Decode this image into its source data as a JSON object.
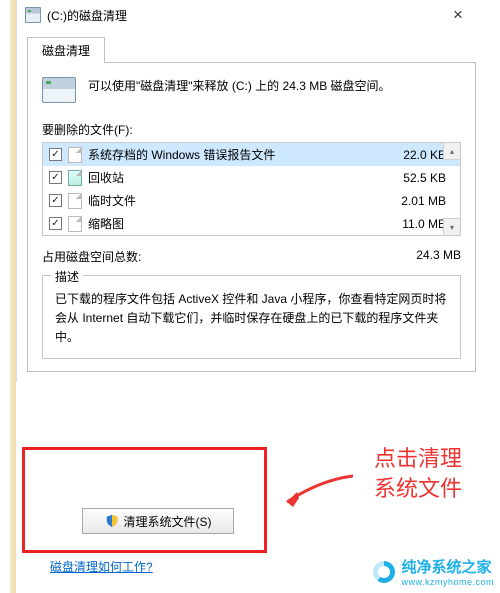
{
  "title": "(C:)的磁盘清理",
  "tab_label": "磁盘清理",
  "summary": "可以使用\"磁盘清理\"来释放  (C:) 上的 24.3 MB 磁盘空间。",
  "files_label": "要删除的文件(F):",
  "files": [
    {
      "name": "系统存档的 Windows 错误报告文件",
      "size": "22.0 KB",
      "checked": true,
      "iconType": "file",
      "selected": true
    },
    {
      "name": "回收站",
      "size": "52.5 KB",
      "checked": true,
      "iconType": "recycle",
      "selected": false
    },
    {
      "name": "临时文件",
      "size": "2.01 MB",
      "checked": true,
      "iconType": "file",
      "selected": false
    },
    {
      "name": "缩略图",
      "size": "11.0 MB",
      "checked": true,
      "iconType": "file",
      "selected": false
    }
  ],
  "total_label": "占用磁盘空间总数:",
  "total_value": "24.3 MB",
  "desc_legend": "描述",
  "desc_text": "已下载的程序文件包括 ActiveX 控件和 Java 小程序，你查看特定网页时将会从 Internet 自动下载它们，并临时保存在硬盘上的已下载的程序文件夹中。",
  "cleanup_button": "清理系统文件(S)",
  "help_link": "磁盘清理如何工作?",
  "annotation_line1": "点击清理",
  "annotation_line2": "系统文件",
  "watermark_title": "纯净系统之家",
  "watermark_sub": "www.kzmyhome.com"
}
